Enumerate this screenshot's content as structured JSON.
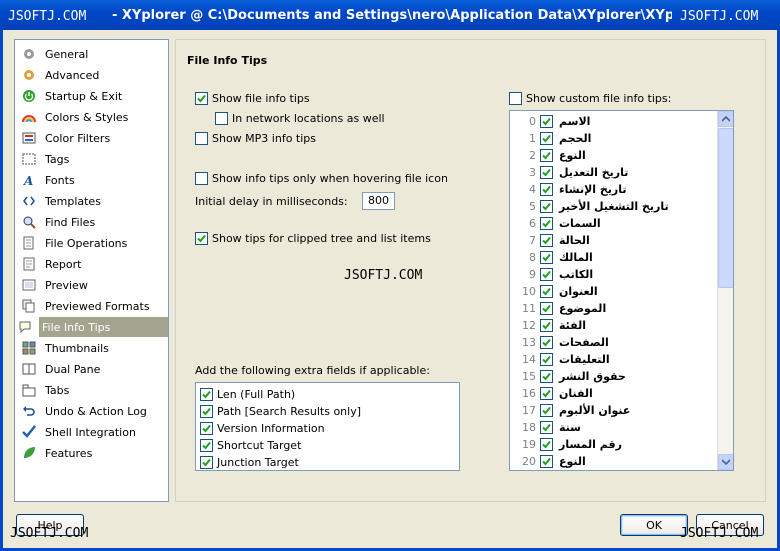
{
  "window": {
    "title": "XYplorer @ C:\\Documents and Settings\\nero\\Application Data\\XYplorer\\XYplorer.ini",
    "title_prefix": "- ",
    "watermark": "JSOFTJ.COM"
  },
  "nav": {
    "items": [
      {
        "label": "General",
        "icon": "gear-icon"
      },
      {
        "label": "Advanced",
        "icon": "gear-advanced-icon"
      },
      {
        "label": "Startup & Exit",
        "icon": "power-icon"
      },
      {
        "label": "Colors & Styles",
        "icon": "rainbow-icon"
      },
      {
        "label": "Color Filters",
        "icon": "color-filter-icon"
      },
      {
        "label": "Tags",
        "icon": "tags-icon"
      },
      {
        "label": "Fonts",
        "icon": "font-icon"
      },
      {
        "label": "Templates",
        "icon": "template-icon"
      },
      {
        "label": "Find Files",
        "icon": "magnifier-icon"
      },
      {
        "label": "File Operations",
        "icon": "file-operations-icon"
      },
      {
        "label": "Report",
        "icon": "report-icon"
      },
      {
        "label": "Preview",
        "icon": "preview-icon"
      },
      {
        "label": "Previewed Formats",
        "icon": "formats-icon"
      },
      {
        "label": "File Info Tips",
        "icon": "speech-bubble-icon"
      },
      {
        "label": "Thumbnails",
        "icon": "thumbnails-icon"
      },
      {
        "label": "Dual Pane",
        "icon": "dual-pane-icon"
      },
      {
        "label": "Tabs",
        "icon": "tabs-icon"
      },
      {
        "label": "Undo & Action Log",
        "icon": "undo-icon"
      },
      {
        "label": "Shell Integration",
        "icon": "checkmark-icon"
      },
      {
        "label": "Features",
        "icon": "leaf-icon"
      }
    ],
    "selected": "File Info Tips"
  },
  "panel": {
    "title": "File Info Tips",
    "show_file_info_tips": {
      "label": "Show file info tips",
      "checked": true
    },
    "network_locations": {
      "label": "In network locations as well",
      "checked": false
    },
    "show_mp3": {
      "label": "Show MP3 info tips",
      "checked": false
    },
    "hover_only": {
      "label": "Show info tips only when hovering file icon",
      "checked": false
    },
    "delay_label": "Initial delay in milliseconds:",
    "delay_value": "800",
    "clipped": {
      "label": "Show tips for clipped tree and list items",
      "checked": true
    },
    "extra_label": "Add the following extra fields if applicable:",
    "extra_fields": [
      {
        "label": "Len (Full Path)",
        "checked": true
      },
      {
        "label": "Path [Search Results only]",
        "checked": true
      },
      {
        "label": "Version Information",
        "checked": true
      },
      {
        "label": "Shortcut Target",
        "checked": true
      },
      {
        "label": "Junction Target",
        "checked": true
      }
    ],
    "custom_tips_label": "Show custom file info tips:",
    "custom_tips_checked": false,
    "custom_fields": [
      {
        "num": "0",
        "label": "الاسم"
      },
      {
        "num": "1",
        "label": "الحجم"
      },
      {
        "num": "2",
        "label": "النوع"
      },
      {
        "num": "3",
        "label": "تاريخ التعديل"
      },
      {
        "num": "4",
        "label": "تاريخ الإنشاء"
      },
      {
        "num": "5",
        "label": "تاريخ التشغيل الأخير"
      },
      {
        "num": "6",
        "label": "السمات"
      },
      {
        "num": "7",
        "label": "الحالة"
      },
      {
        "num": "8",
        "label": "المالك"
      },
      {
        "num": "9",
        "label": "الكاتب"
      },
      {
        "num": "10",
        "label": "العنوان"
      },
      {
        "num": "11",
        "label": "الموضوع"
      },
      {
        "num": "12",
        "label": "الفئة"
      },
      {
        "num": "13",
        "label": "الصفحات"
      },
      {
        "num": "14",
        "label": "التعليقات"
      },
      {
        "num": "15",
        "label": "حقوق النشر"
      },
      {
        "num": "16",
        "label": "الفنان"
      },
      {
        "num": "17",
        "label": "عنوان الألبوم"
      },
      {
        "num": "18",
        "label": "سنة"
      },
      {
        "num": "19",
        "label": "رقم المسار"
      },
      {
        "num": "20",
        "label": "النوع"
      }
    ]
  },
  "buttons": {
    "help": "Help",
    "ok": "OK",
    "cancel": "Cancel"
  },
  "colors": {
    "title_bar": "#0048c8",
    "selected_nav": "#a3a58e",
    "check": "#21a121"
  }
}
